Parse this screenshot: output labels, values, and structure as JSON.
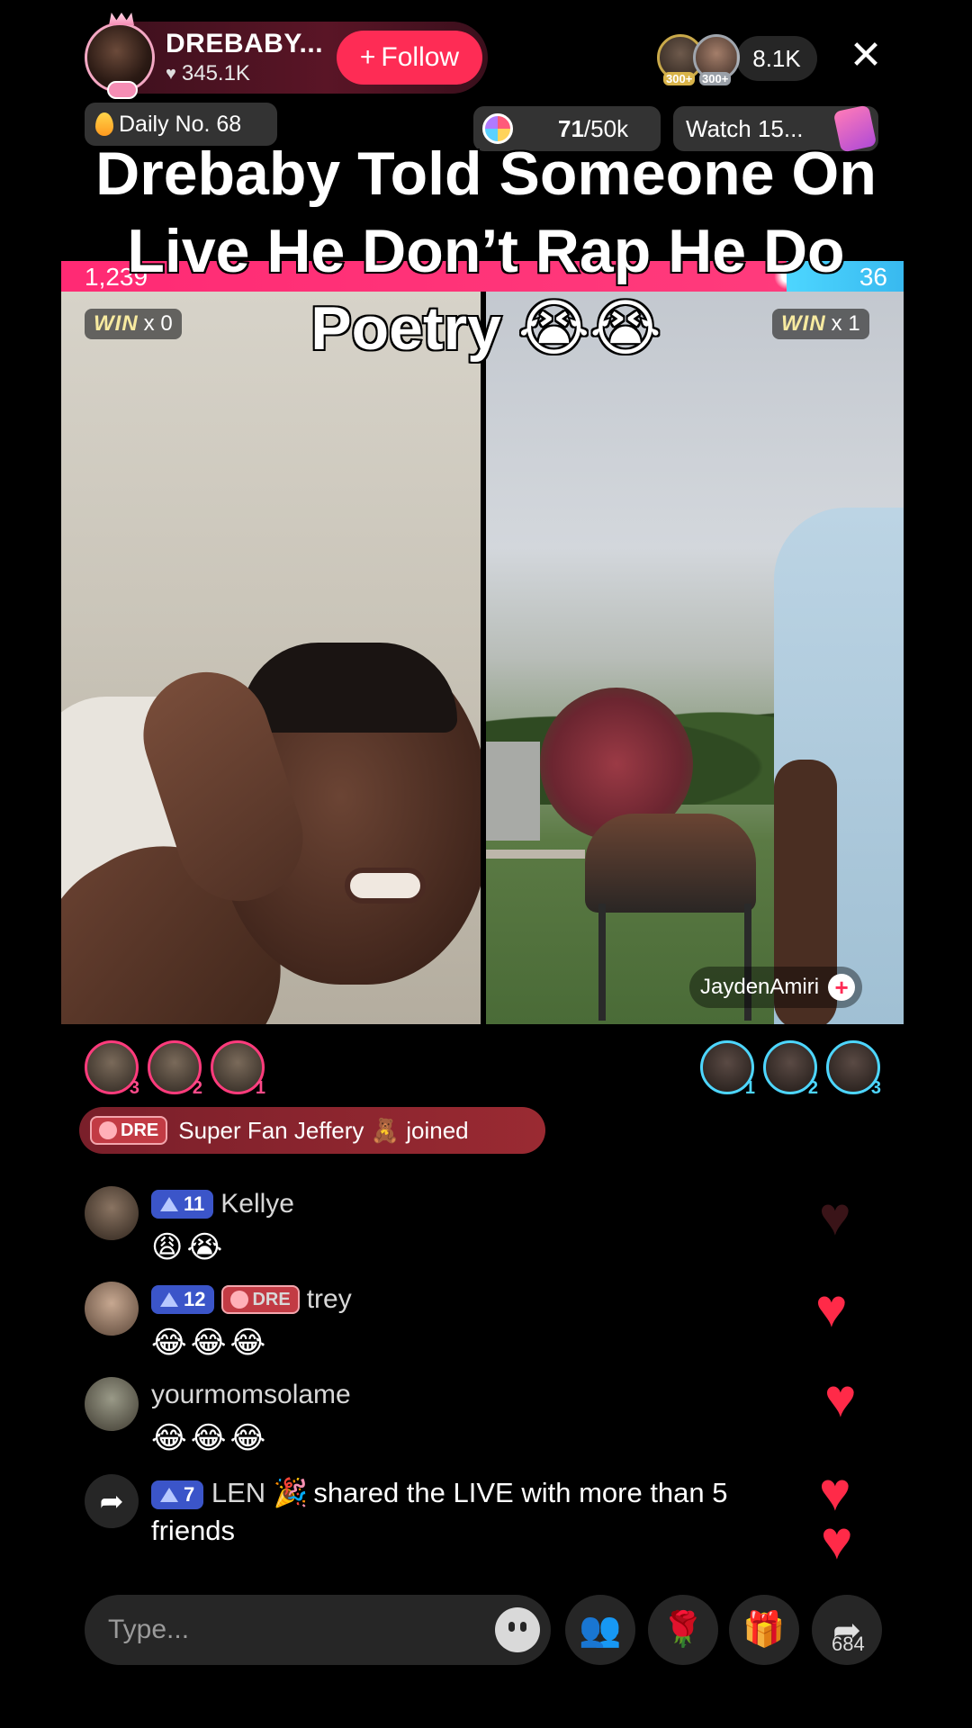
{
  "header": {
    "host_name": "DREBABY...",
    "host_likes": "345.1K",
    "follow_label": "Follow",
    "viewer_count": "8.1K",
    "viewer_badges": [
      "300+",
      "300+"
    ]
  },
  "stats_row": {
    "daily_rank": "Daily No. 68",
    "goal_current": "71",
    "goal_target": "/50k",
    "watch_label": "Watch 15..."
  },
  "battle": {
    "left_score": "1,239",
    "right_score": "36",
    "left_win_count": "x 0",
    "right_win_count": "x 1",
    "win_word": "WIN",
    "opponent_name": "JaydenAmiri"
  },
  "caption": "Drebaby Told Someone On Live He Don’t Rap He Do Poetry 😭😭",
  "gifters": {
    "left_ranks": [
      "3",
      "2",
      "1"
    ],
    "right_ranks": [
      "1",
      "2",
      "3"
    ]
  },
  "join_notice": {
    "badge": "DRE",
    "text": "Super Fan Jeffery 🧸 joined"
  },
  "chat": [
    {
      "level": "11",
      "fan_badge": "",
      "name": "Kellye",
      "message": "😩😭"
    },
    {
      "level": "12",
      "fan_badge": "DRE",
      "name": "trey",
      "message": "😂😂😂"
    },
    {
      "level": "",
      "fan_badge": "",
      "name": "yourmomsolame",
      "message": "😂😂😂"
    }
  ],
  "share_notice": {
    "level": "7",
    "name": "LEN 🎉",
    "text": "shared the LIVE with more than 5 friends"
  },
  "bottom_bar": {
    "input_placeholder": "Type...",
    "share_count": "684"
  },
  "colors": {
    "follow_red": "#fe2c55",
    "battle_pink": "#ff2a74",
    "battle_blue": "#4dd6ff",
    "like_heart": "#ff2a48"
  }
}
